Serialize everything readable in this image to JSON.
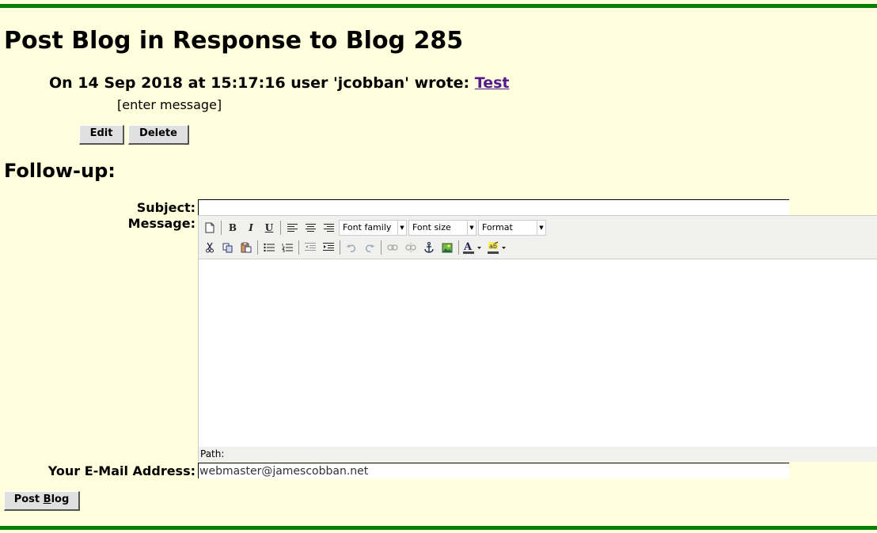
{
  "page": {
    "title": "Post Blog in Response to Blog 285"
  },
  "blog": {
    "header_prefix": "On 14 Sep 2018 at 15:17:16 user 'jcobban' wrote: ",
    "link_text": "Test",
    "body": "[enter message]",
    "edit_label": "Edit",
    "delete_label": "Delete"
  },
  "followup": {
    "title": "Follow-up:",
    "subject_label": "Subject:",
    "subject_value": "",
    "message_label": "Message:",
    "email_label": "Your E-Mail Address:",
    "email_value": "webmaster@jamescobban.net",
    "post_label_pre": "Post ",
    "post_label_accel": "B",
    "post_label_post": "log"
  },
  "editor": {
    "font_family": "Font family",
    "font_size": "Font size",
    "format": "Format",
    "status_path": "Path:",
    "toolbar_icons": [
      "new-document-icon",
      "bold-icon",
      "italic-icon",
      "underline-icon",
      "align-left-icon",
      "align-center-icon",
      "align-right-icon",
      "cut-icon",
      "copy-icon",
      "paste-icon",
      "bullet-list-icon",
      "numbered-list-icon",
      "outdent-icon",
      "indent-icon",
      "undo-icon",
      "redo-icon",
      "link-icon",
      "unlink-icon",
      "anchor-icon",
      "image-icon",
      "text-color-icon",
      "highlight-color-icon"
    ]
  },
  "colors": {
    "background": "#ffffdd",
    "rule": "#008000",
    "link": "#551a8b"
  }
}
